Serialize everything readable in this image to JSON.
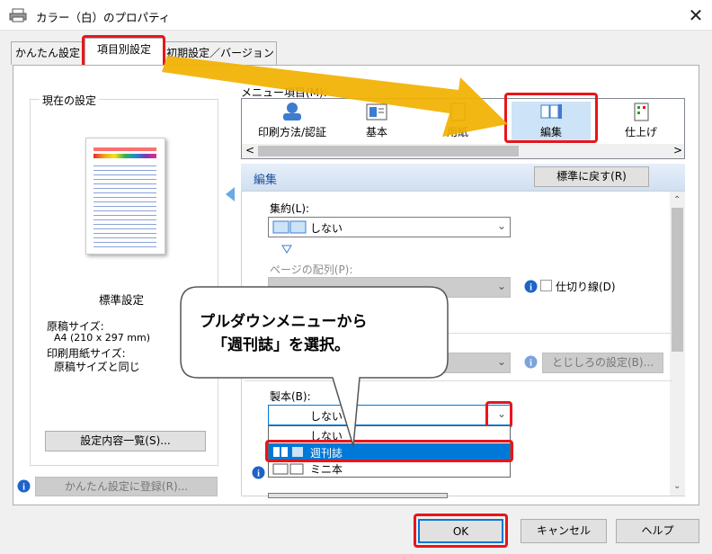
{
  "window": {
    "title": "カラー（白）のプロパティ",
    "close": "✕"
  },
  "tabs": [
    {
      "label": "かんたん設定"
    },
    {
      "label": "項目別設定"
    },
    {
      "label": "初期設定／バージョン"
    }
  ],
  "left": {
    "current_settings_label": "現在の設定",
    "preset_name": "標準設定",
    "original_size_label": "原稿サイズ:",
    "original_size_value": "A4 (210 x 297 mm)",
    "paper_size_label": "印刷用紙サイズ:",
    "paper_size_value": "原稿サイズと同じ",
    "settings_list_button": "設定内容一覧(S)...",
    "register_button": "かんたん設定に登録(R)..."
  },
  "menu": {
    "label": "メニュー項目(M):",
    "items": [
      {
        "label": "印刷方法/認証",
        "icon": "print-method-icon"
      },
      {
        "label": "基本",
        "icon": "basic-icon"
      },
      {
        "label": "用紙",
        "icon": "paper-icon"
      },
      {
        "label": "編集",
        "icon": "edit-icon"
      },
      {
        "label": "仕上げ",
        "icon": "finishing-icon"
      }
    ],
    "scroll_left": "<",
    "scroll_right": ">"
  },
  "section": {
    "title": "編集",
    "reset_button": "標準に戻す(R)"
  },
  "fields": {
    "combine_label": "集約(L):",
    "combine_value": "しない",
    "page_order_label": "ページの配列(P):",
    "separator_label": "仕切り線(D)",
    "binding_settings_button": "とじしろの設定(B)...",
    "booklet_label": "製本(B):",
    "booklet_value": "しない",
    "booklet_options": [
      "しない",
      "週刊誌",
      "ミニ本"
    ]
  },
  "overlay": {
    "line1": "プルダウンメニューから",
    "line2": "「週刊誌」を選択。"
  },
  "footer": {
    "ok": "OK",
    "cancel": "キャンセル",
    "help": "ヘルプ"
  },
  "colors": {
    "accent": "#0078d7",
    "highlight_red": "#e8151b",
    "arrow": "#f2b100"
  }
}
